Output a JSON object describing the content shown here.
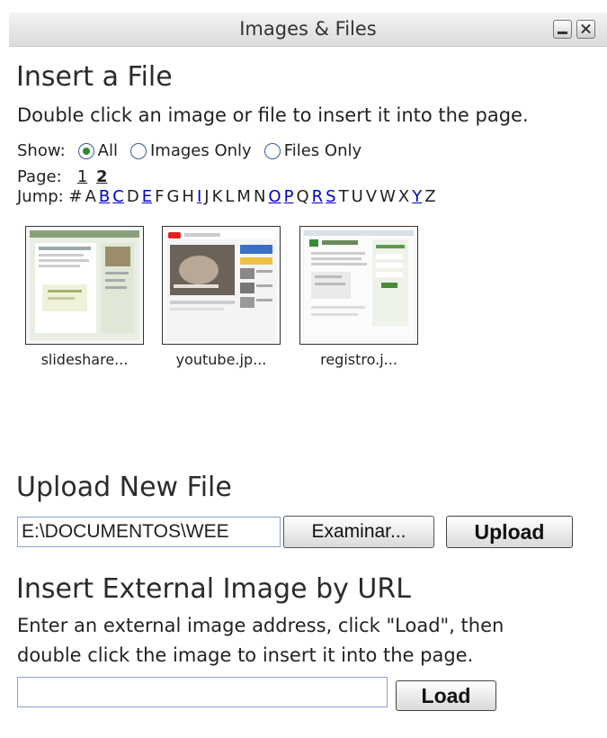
{
  "window": {
    "title": "Images & Files"
  },
  "insert_file": {
    "heading": "Insert a File",
    "instructions": "Double click an image or file to insert it into the page.",
    "show_label": "Show:",
    "filters": [
      {
        "label": "All",
        "selected": true
      },
      {
        "label": "Images Only",
        "selected": false
      },
      {
        "label": "Files Only",
        "selected": false
      }
    ],
    "page_label": "Page:",
    "pages": [
      "1",
      "2"
    ],
    "current_page": "2",
    "jump_label": "Jump:",
    "jump_letters": [
      {
        "ch": "#",
        "link": false
      },
      {
        "ch": "A",
        "link": false
      },
      {
        "ch": "B",
        "link": true
      },
      {
        "ch": "C",
        "link": true
      },
      {
        "ch": "D",
        "link": false
      },
      {
        "ch": "E",
        "link": true
      },
      {
        "ch": "F",
        "link": false
      },
      {
        "ch": "G",
        "link": false
      },
      {
        "ch": "H",
        "link": false
      },
      {
        "ch": "I",
        "link": true
      },
      {
        "ch": "J",
        "link": false
      },
      {
        "ch": "K",
        "link": false
      },
      {
        "ch": "L",
        "link": false
      },
      {
        "ch": "M",
        "link": false
      },
      {
        "ch": "N",
        "link": false
      },
      {
        "ch": "O",
        "link": true
      },
      {
        "ch": "P",
        "link": true
      },
      {
        "ch": "Q",
        "link": false
      },
      {
        "ch": "R",
        "link": true
      },
      {
        "ch": "S",
        "link": true
      },
      {
        "ch": "T",
        "link": false
      },
      {
        "ch": "U",
        "link": false
      },
      {
        "ch": "V",
        "link": false
      },
      {
        "ch": "W",
        "link": false
      },
      {
        "ch": "X",
        "link": false
      },
      {
        "ch": "Y",
        "link": true
      },
      {
        "ch": "Z",
        "link": false
      }
    ],
    "files": [
      {
        "label": "slideshare..."
      },
      {
        "label": "youtube.jp..."
      },
      {
        "label": "registro.j..."
      }
    ]
  },
  "upload": {
    "heading": "Upload New File",
    "path_value": "E:\\DOCUMENTOS\\WEE",
    "browse_label": "Examinar...",
    "upload_label": "Upload"
  },
  "external": {
    "heading": "Insert External Image by URL",
    "instructions_line1": "Enter an external image address, click \"Load\", then",
    "instructions_line2": "double click the image to insert it into the page.",
    "url_value": "",
    "load_label": "Load"
  }
}
